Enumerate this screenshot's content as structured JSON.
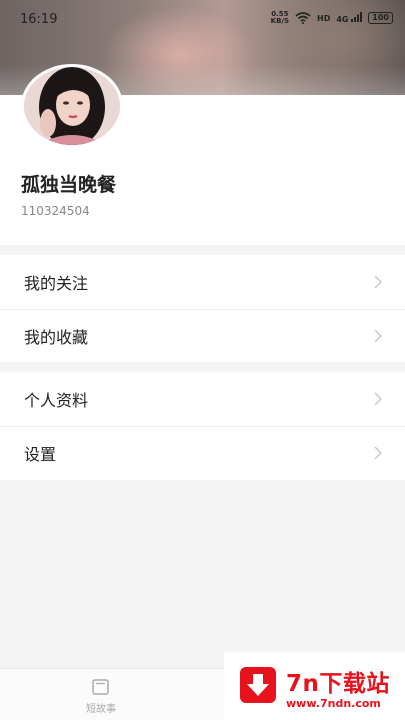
{
  "status_bar": {
    "time": "16:19",
    "net_speed_value": "0.55",
    "net_speed_unit": "KB/S",
    "hd_label": "HD",
    "signal_label": "4G",
    "battery": "100"
  },
  "profile": {
    "nickname": "孤独当晚餐",
    "user_id": "110324504"
  },
  "menu": {
    "group1": [
      {
        "label": "我的关注"
      },
      {
        "label": "我的收藏"
      }
    ],
    "group2": [
      {
        "label": "个人资料"
      },
      {
        "label": "设置"
      }
    ]
  },
  "tabbar": {
    "tabs": [
      {
        "label": "短故事",
        "icon": "square-icon"
      }
    ]
  },
  "watermark": {
    "title": "7n下载站",
    "url": "www.7ndn.com"
  },
  "colors": {
    "brand_red": "#e8121c",
    "divider": "#efefef",
    "background": "#f4f4f4"
  }
}
